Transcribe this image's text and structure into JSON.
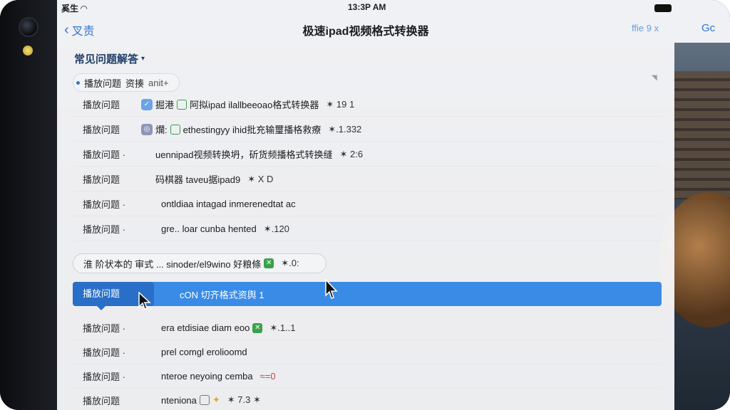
{
  "status": {
    "left": "奚生",
    "time": "13:3P AM"
  },
  "nav": {
    "back_label": "叉责",
    "title": "极速ipad视频格式转换器",
    "filter_label": "ffie 9 x",
    "go_label": "Gc"
  },
  "section": {
    "title": "常见问题解答"
  },
  "top_chip": {
    "label": "播放问题",
    "text": "资揍",
    "extra": "anit+"
  },
  "rows": [
    {
      "cat": "播放问题",
      "text": "掘港",
      "text2": "阿拟ipad ilallbeeoao格式转换器",
      "tail": "✶ 19 1"
    },
    {
      "cat": "播放问题",
      "text": "爛:",
      "text2": "ethestingyy ihid批充输璽播格救療",
      "tail": "✶.1.332"
    },
    {
      "cat": "播放问题 ·",
      "text": "uennipad视频转换坍，斫货频播格式转换缝",
      "tail": "✶ 2:6"
    },
    {
      "cat": "播放问题",
      "text": "码棋器 taveu据ipad9",
      "tail": "✶ X D"
    },
    {
      "cat": "播放问题 ·",
      "text": "ontldiaa intagad inmerenedtat ac",
      "tail": ""
    },
    {
      "cat": "播放问题 ·",
      "text": "gre.. loar cunba hented",
      "tail": "✶.120"
    }
  ],
  "suggest": {
    "text": "淮 阶状本的 审式 ... sinoder/el9wino 好粮條",
    "tail": "✶.0:"
  },
  "selected": {
    "cat": "播放问题",
    "text": "cON 切齐格式资舆 1"
  },
  "rows_bottom": [
    {
      "cat": "播放问题 ·",
      "text": "era etdisiae diam eoo",
      "tail": "✶.1..1"
    },
    {
      "cat": "播放问题 ·",
      "text": "prel comgl erolioomd",
      "tail": ""
    },
    {
      "cat": "播放问题 ·",
      "text": "nteroe neyoing cemba",
      "tail": "≈=0"
    },
    {
      "cat": "播放问题",
      "text": "nteniona",
      "tail": "✶ 7.3 ✶"
    }
  ],
  "colors": {
    "accent": "#2f74d0",
    "selected": "#3a8be6"
  }
}
